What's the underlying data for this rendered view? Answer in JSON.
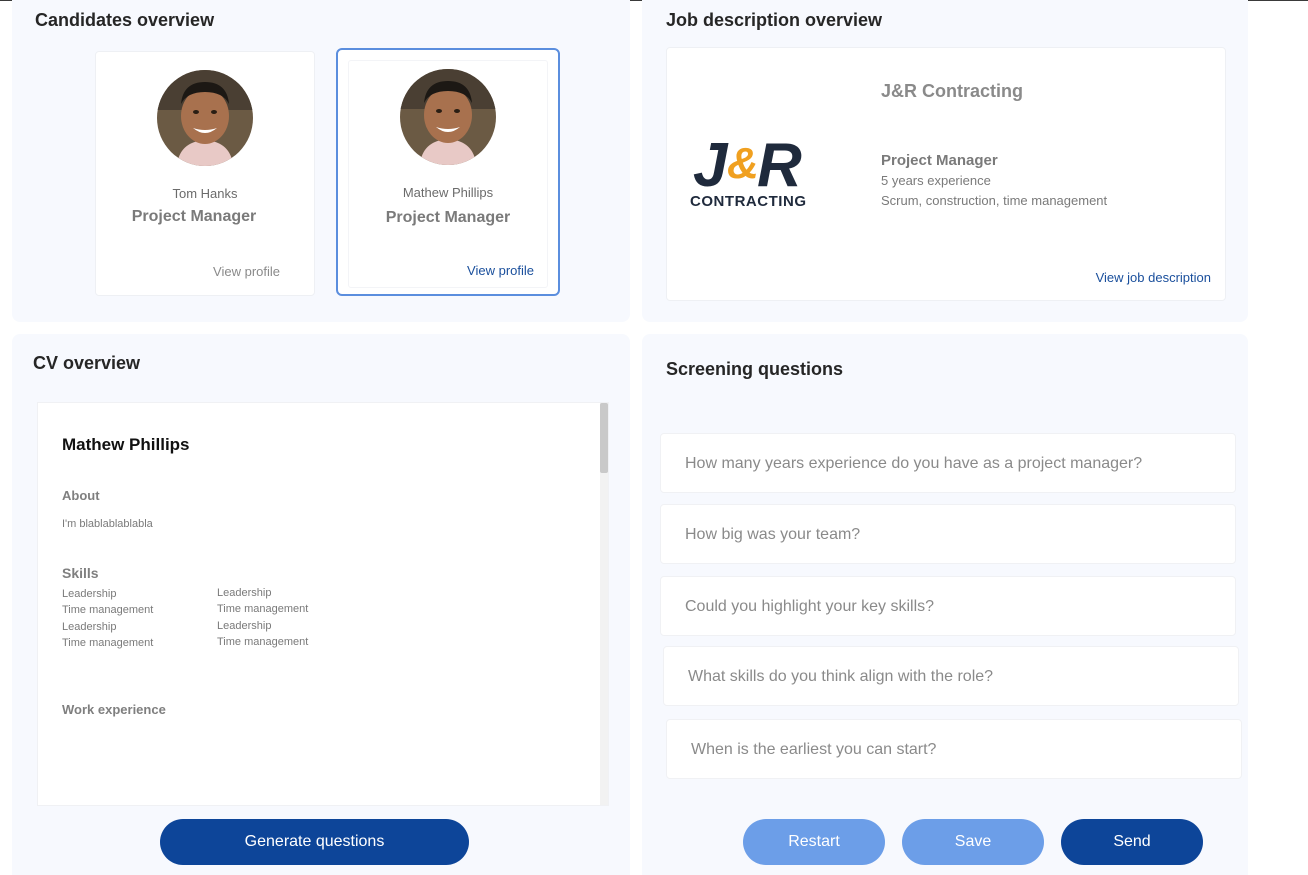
{
  "candidates": {
    "title": "Candidates overview",
    "cards": [
      {
        "name": "Tom Hanks",
        "role": "Project Manager",
        "link": "View profile",
        "selected": false
      },
      {
        "name": "Mathew Phillips",
        "role": "Project Manager",
        "link": "View profile",
        "selected": true
      }
    ]
  },
  "job": {
    "title": "Job description overview",
    "company": "J&R Contracting",
    "logo_text": "J&R",
    "logo_subtext": "CONTRACTING",
    "role": "Project Manager",
    "experience": "5 years experience",
    "keywords": "Scrum, construction, time management",
    "link": "View job description"
  },
  "cv": {
    "title": "CV overview",
    "name": "Mathew Phillips",
    "about_heading": "About",
    "about_text": "I'm blablablablabla",
    "skills_heading": "Skills",
    "skills_col1": [
      "Leadership",
      "Time management",
      "Leadership",
      "Time management"
    ],
    "skills_col2": [
      "Leadership",
      "Time management",
      "Leadership",
      "Time management"
    ],
    "work_heading": "Work experience",
    "generate_label": "Generate questions"
  },
  "screening": {
    "title": "Screening questions",
    "questions": [
      "How many years experience do you have as a project manager?",
      "How big was your team?",
      "Could you highlight your key skills?",
      "What skills do you think align with the role?",
      "When is the earliest you can start?"
    ],
    "restart_label": "Restart",
    "save_label": "Save",
    "send_label": "Send"
  },
  "colors": {
    "panel_bg": "#f7f9fe",
    "primary": "#0d4599",
    "primary_light": "#6c9ee8",
    "selected_border": "#5b8ede",
    "link": "#1a4f9c",
    "logo_navy": "#1f2a3c",
    "logo_orange": "#f0a020"
  }
}
